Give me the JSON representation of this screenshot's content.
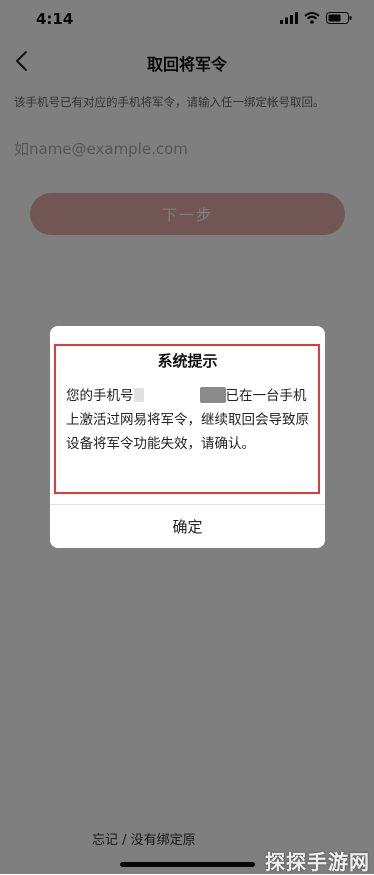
{
  "status_bar": {
    "time": "4:14"
  },
  "nav": {
    "title": "取回将军令"
  },
  "description": "该手机号已有对应的手机将军令，请输入任一绑定帐号取回。",
  "input": {
    "placeholder": "如name@example.com",
    "value": ""
  },
  "next_button": {
    "label": "下一步"
  },
  "footer": {
    "link_text": "忘记 / 没有绑定原"
  },
  "watermark": {
    "text": "探探手游网"
  },
  "dialog": {
    "title": "系统提示",
    "message_prefix": "您的手机号",
    "message_line1_suffix": "已在一台手",
    "message_rest": "机上激活过网易将军令，继续取回会导致原设备将军令功能失效，请确认。",
    "confirm_label": "确定"
  },
  "colors": {
    "accent_red": "#c8313a",
    "highlight_border": "#e03a3a",
    "overlay": "rgba(0,0,0,0.5)"
  },
  "icons": {
    "back": "chevron-left-icon",
    "signal": "signal-icon",
    "wifi": "wifi-icon",
    "battery": "battery-icon"
  }
}
